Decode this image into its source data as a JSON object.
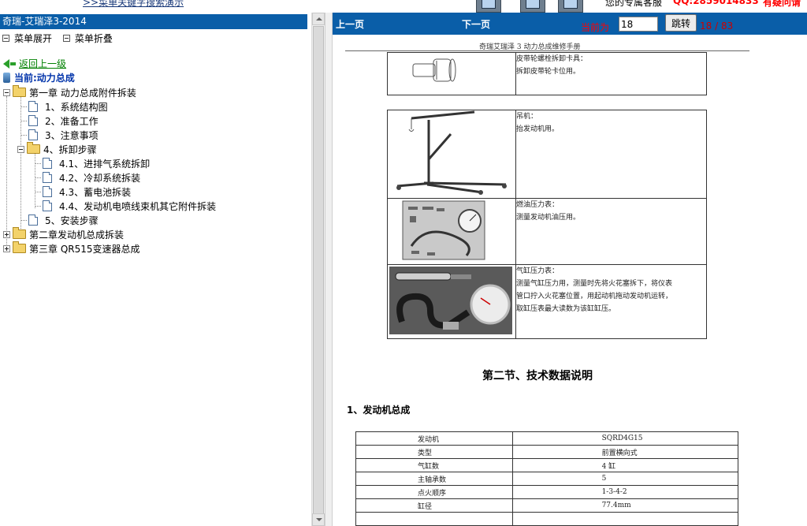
{
  "top": {
    "link_text": ">>菜单关键字搜索演示",
    "right_text": "您的专属客服",
    "red_text": "QQ:2859014833",
    "red_text2": "有疑问请"
  },
  "left": {
    "title": "奇瑞-艾瑞泽3-2014",
    "expand_label": "菜单展开",
    "collapse_label": "菜单折叠",
    "back_label": "返回上一级",
    "current_label": "当前:动力总成",
    "tree": {
      "ch1": "第一章 动力总成附件拆装",
      "i1": "1、系统结构图",
      "i2": "2、准备工作",
      "i3": "3、注意事项",
      "i4": "4、拆卸步骤",
      "i41": "4.1、进排气系统拆卸",
      "i42": "4.2、冷却系统拆装",
      "i43": "4.3、蓄电池拆装",
      "i44": "4.4、发动机电喷线束机其它附件拆装",
      "i5": "5、安装步骤",
      "ch2": "第二章发动机总成拆装",
      "ch3": "第三章 QR515变速器总成"
    }
  },
  "nav": {
    "prev": "上一页",
    "next": "下一页",
    "current_page_label": "当前为",
    "page_value": "18",
    "jump": "跳转",
    "page_count": "18 / 83"
  },
  "doc": {
    "header": "奇瑞艾瑞泽 3 动力总成维修手册",
    "tools": {
      "t1_l1": "皮带轮螺栓拆卸卡具：",
      "t1_l2": "拆卸皮带轮卡位用。",
      "t2_l1": "吊机：",
      "t2_l2": "抬发动机用。",
      "t3_l1": "燃油压力表：",
      "t3_l2": "测量发动机油压用。",
      "t4_l1": "气缸压力表：",
      "t4_l2": "测量气缸压力用，测量时先将火花塞拆下，将仪表",
      "t4_l3": "管口拧入火花塞位置，用起动机拖动发动机运转，",
      "t4_l4": "取缸压表最大读数为该缸缸压。"
    },
    "section_title": "第二节、技术数据说明",
    "sub_title": "1、发动机总成",
    "specs": [
      {
        "k": "发动机",
        "v": "SQRD4G15"
      },
      {
        "k": "类型",
        "v": "前置横向式"
      },
      {
        "k": "气缸数",
        "v": "4 缸"
      },
      {
        "k": "主轴承数",
        "v": "5"
      },
      {
        "k": "点火顺序",
        "v": "1-3-4-2"
      },
      {
        "k": "缸径",
        "v": "77.4mm"
      },
      {
        "k": "",
        "v": ""
      }
    ]
  }
}
